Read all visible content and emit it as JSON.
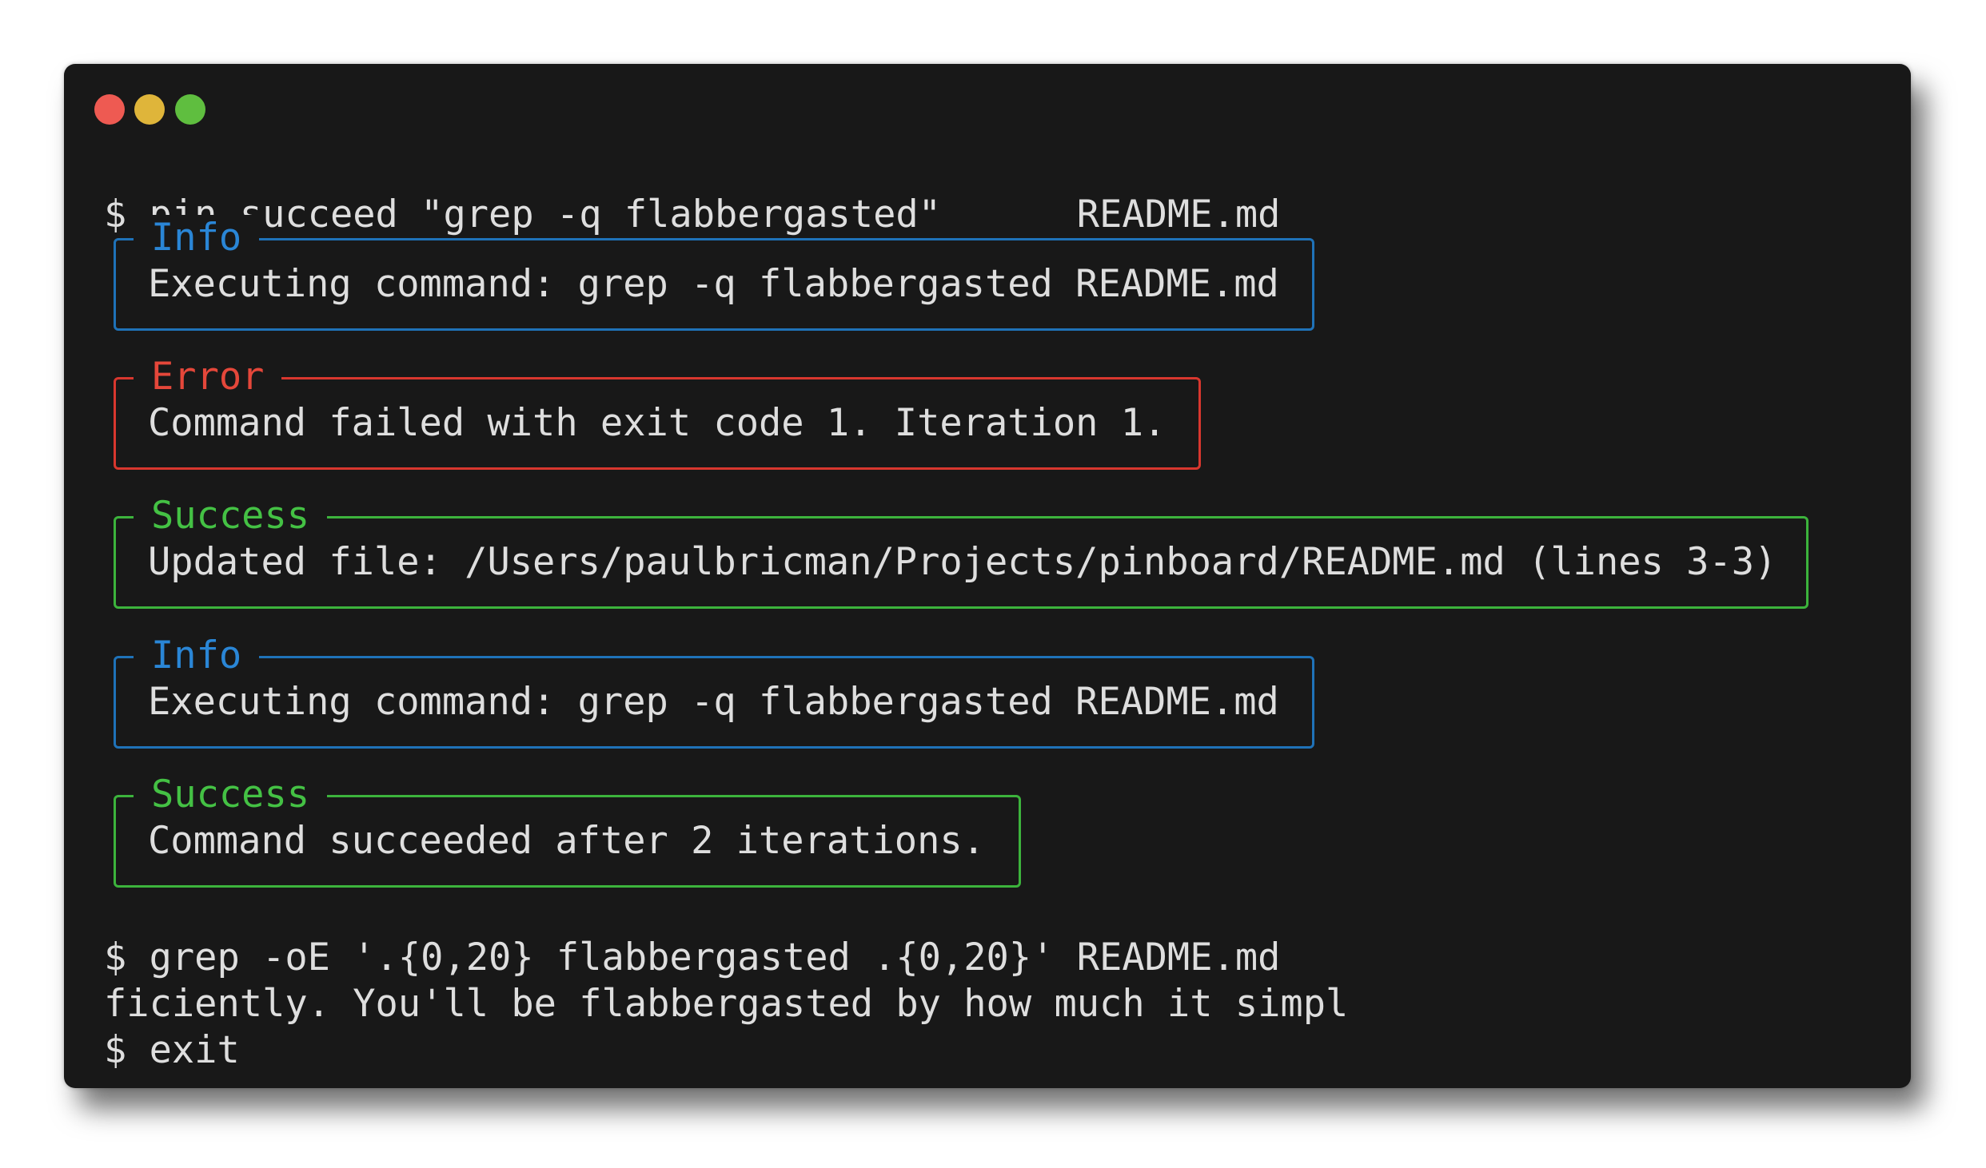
{
  "window": {
    "buttons": [
      "close",
      "minimize",
      "maximize"
    ],
    "colors": {
      "close": "#ee5a52",
      "minimize": "#dfb53a",
      "maximize": "#5fbe3f",
      "background": "#181818"
    }
  },
  "terminal": {
    "command1": "$ pin succeed \"grep -q flabbergasted\"      README.md",
    "panels": [
      {
        "type": "info",
        "title": "Info",
        "message": "Executing command: grep -q flabbergasted README.md"
      },
      {
        "type": "error",
        "title": "Error",
        "message": "Command failed with exit code 1. Iteration 1."
      },
      {
        "type": "success",
        "title": "Success",
        "message": "Updated file: /Users/paulbricman/Projects/pinboard/README.md (lines 3-3)"
      },
      {
        "type": "info",
        "title": "Info",
        "message": "Executing command: grep -q flabbergasted README.md"
      },
      {
        "type": "success",
        "title": "Success",
        "message": "Command succeeded after 2 iterations."
      }
    ],
    "command2": "$ grep -oE '.{0,20} flabbergasted .{0,20}' README.md",
    "output2": "ficiently. You'll be flabbergasted by how much it simpl",
    "command3": "$ exit"
  },
  "colors": {
    "info": "#2a86d6",
    "error": "#e5473a",
    "success": "#44c144",
    "text": "#dedede"
  }
}
